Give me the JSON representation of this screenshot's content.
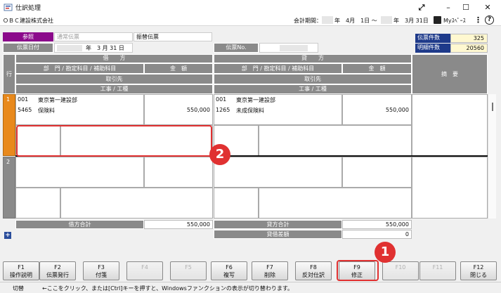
{
  "window": {
    "title": "仕訳処理",
    "minimize": "–",
    "maximize": "☐",
    "close": "✕",
    "expand": "⤢"
  },
  "infobar": {
    "company": "ＯＢＣ建設株式会社",
    "period_label": "会計期間：",
    "period_start": "年　4月　1日 ～",
    "period_end": "年　3月 31日",
    "my_space": "Myｽﾍﾟｰｽ",
    "more": "⋮",
    "help": "?"
  },
  "voucher": {
    "ref_tab": "参照",
    "type_normal": "通常伝票",
    "type_transfer": "振替伝票",
    "date_label": "伝票日付",
    "date_value": "年　3 月 31 日",
    "no_label": "伝票No."
  },
  "counts": {
    "voucher_label": "伝票件数",
    "voucher_value": "325",
    "detail_label": "明細件数",
    "detail_value": "20560"
  },
  "headers": {
    "row": "行",
    "debit": "借　　方",
    "credit": "貸　　方",
    "dept_account": "部　門 / 勘定科目 / 補助科目",
    "amount": "金　額",
    "partner": "取引先",
    "work": "工事 / 工種",
    "memo": "摘　要"
  },
  "rows": [
    {
      "num": "1",
      "debit_dept_code": "001",
      "debit_dept": "東京第一建設部",
      "debit_acc_code": "5465",
      "debit_acc": "保険料",
      "debit_amount": "550,000",
      "credit_dept_code": "001",
      "credit_dept": "東京第一建設部",
      "credit_acc_code": "1265",
      "credit_acc": "未成保険料",
      "credit_amount": "550,000"
    },
    {
      "num": "2"
    }
  ],
  "totals": {
    "debit_label": "借方合計",
    "debit_value": "550,000",
    "credit_label": "貸方合計",
    "credit_value": "550,000",
    "diff_label": "貸借差額",
    "diff_value": "0",
    "expand": "+"
  },
  "fkeys": [
    {
      "key": "F1",
      "label": "操作説明",
      "enabled": true
    },
    {
      "key": "F2",
      "label": "伝票発行",
      "enabled": true
    },
    {
      "key": "F3",
      "label": "付箋",
      "enabled": true
    },
    {
      "key": "F4",
      "label": "",
      "enabled": false
    },
    {
      "key": "F5",
      "label": "",
      "enabled": false
    },
    {
      "key": "F6",
      "label": "複写",
      "enabled": true
    },
    {
      "key": "F7",
      "label": "削除",
      "enabled": true
    },
    {
      "key": "F8",
      "label": "反対仕訳",
      "enabled": true
    },
    {
      "key": "F9",
      "label": "修正",
      "enabled": true
    },
    {
      "key": "F10",
      "label": "",
      "enabled": false
    },
    {
      "key": "F11",
      "label": "",
      "enabled": false
    },
    {
      "key": "F12",
      "label": "閉じる",
      "enabled": true
    }
  ],
  "status": {
    "toggle": "切替",
    "hint": "←ここをクリック、または[Ctrl]キーを押すと、Windowsファンクションの表示が切り替わります。"
  },
  "callouts": {
    "one": "1",
    "two": "2"
  },
  "colors": {
    "ref_tab": "#8b0a8b",
    "header": "#8a8a8a",
    "row_marker": "#e8891c",
    "callout": "#e03131",
    "count_label": "#1e3a8a"
  }
}
